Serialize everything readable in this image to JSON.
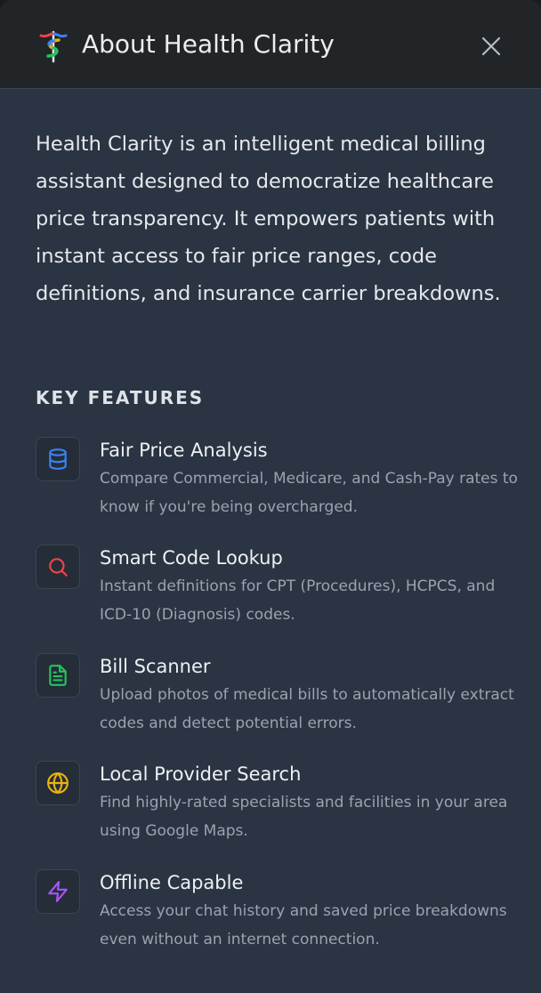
{
  "header": {
    "title": "About Health Clarity",
    "close_icon": "close-icon",
    "logo_icon": "caduceus-logo-icon"
  },
  "intro": {
    "text": "Health Clarity is an intelligent medical billing assistant designed to democratize healthcare price transparency. It empowers patients with instant access to fair price ranges, code definitions, and insurance carrier breakdowns."
  },
  "features_section": {
    "heading": "KEY FEATURES",
    "items": [
      {
        "title": "Fair Price Analysis",
        "description": "Compare Commercial, Medicare, and Cash-Pay rates to know if you're being overcharged.",
        "icon": "database-icon",
        "color": "#3b82f6"
      },
      {
        "title": "Smart Code Lookup",
        "description": "Instant definitions for CPT (Procedures), HCPCS, and ICD-10 (Diagnosis) codes.",
        "icon": "search-icon",
        "color": "#ef4444"
      },
      {
        "title": "Bill Scanner",
        "description": "Upload photos of medical bills to automatically extract codes and detect potential errors.",
        "icon": "file-text-icon",
        "color": "#22c55e"
      },
      {
        "title": "Local Provider Search",
        "description": "Find highly-rated specialists and facilities in your area using Google Maps.",
        "icon": "globe-icon",
        "color": "#eab308"
      },
      {
        "title": "Offline Capable",
        "description": "Access your chat history and saved price breakdowns even without an internet connection.",
        "icon": "lightning-icon",
        "color": "#a855f7"
      }
    ]
  }
}
